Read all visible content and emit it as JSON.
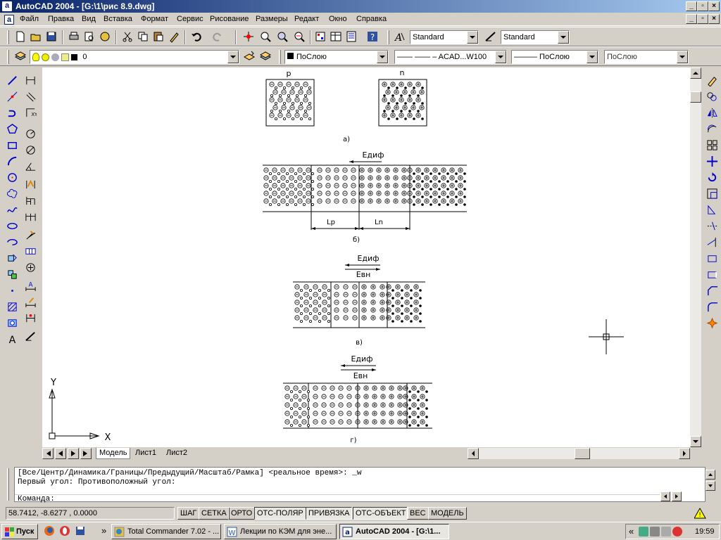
{
  "window": {
    "title": "AutoCAD 2004 - [G:\\1\\рис 8.9.dwg]",
    "app_icon_letter": "a"
  },
  "menu": [
    "Файл",
    "Правка",
    "Вид",
    "Вставка",
    "Формат",
    "Сервис",
    "Рисование",
    "Размеры",
    "Редакт",
    "Окно",
    "Справка"
  ],
  "toolbar": {
    "text_style": "Standard",
    "dim_style": "Standard",
    "layer": "0",
    "color": "ПоСлою",
    "linetype": "—— —— – ACAD...W100",
    "lineweight": "——— ПоСлою",
    "plotstyle": "ПоСлою"
  },
  "drawing": {
    "a_label_p": "p",
    "a_label_n": "n",
    "a_caption": "а)",
    "b_field": "Eдиф",
    "b_lp": "Lp",
    "b_ln": "Ln",
    "b_caption": "б)",
    "c_field1": "Eдиф",
    "c_field2": "Евн",
    "c_caption": "в)",
    "d_field1": "Eдиф",
    "d_field2": "Евн",
    "d_caption": "г)",
    "ucs_x": "X",
    "ucs_y": "Y"
  },
  "tabs": [
    "Модель",
    "Лист1",
    "Лист2"
  ],
  "command": {
    "line1": "[Все/Центр/Динамика/Границы/Предыдущий/Масштаб/Рамка] <реальное время>: _w",
    "line2": "Первый угол: Противоположный угол:",
    "line3": "Команда:"
  },
  "status": {
    "coords": "58.7412, -8.6277 , 0.0000",
    "toggles": [
      "ШАГ",
      "СЕТКА",
      "ОРТО",
      "ОТС-ПОЛЯР",
      "ПРИВЯЗКА",
      "ОТС-ОБЪЕКТ",
      "ВЕС",
      "МОДЕЛЬ"
    ]
  },
  "taskbar": {
    "start": "Пуск",
    "items": [
      "Total Commander 7.02 - ...",
      "Лекции по КЭМ для эне...",
      "AutoCAD 2004 - [G:\\1..."
    ],
    "clock": "19:59",
    "more": "»"
  }
}
